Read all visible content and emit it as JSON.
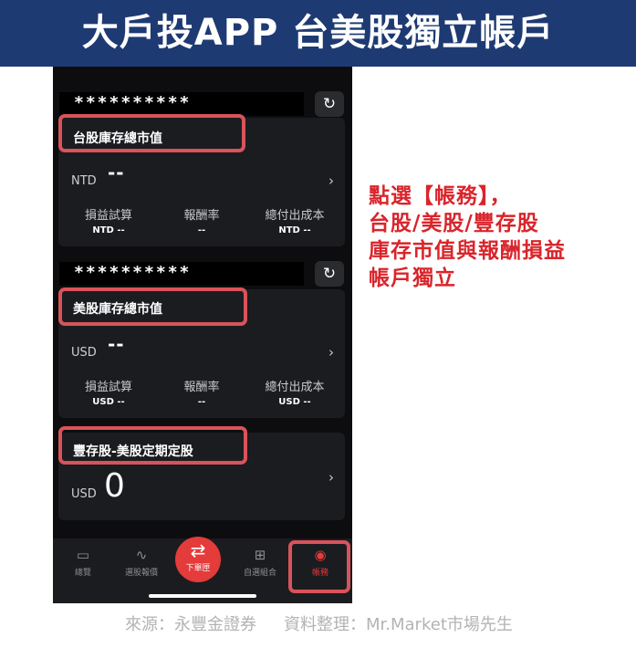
{
  "banner": {
    "title": "大戶投APP 台美股獨立帳戶"
  },
  "accounts": [
    {
      "masked_id": "**********",
      "title": "台股庫存總市值",
      "currency": "NTD",
      "value": "--",
      "stats": [
        {
          "label": "損益試算",
          "value": "NTD --"
        },
        {
          "label": "報酬率",
          "value": "--"
        },
        {
          "label": "總付出成本",
          "value": "NTD --"
        }
      ]
    },
    {
      "masked_id": "**********",
      "title": "美股庫存總市值",
      "currency": "USD",
      "value": "--",
      "stats": [
        {
          "label": "損益試算",
          "value": "USD --"
        },
        {
          "label": "報酬率",
          "value": "--"
        },
        {
          "label": "總付出成本",
          "value": "USD --"
        }
      ]
    },
    {
      "title": "豐存股-美股定期定股",
      "currency": "USD",
      "value": "0"
    }
  ],
  "tabbar": {
    "items": [
      {
        "label": "總覽",
        "icon": "monitor-icon"
      },
      {
        "label": "選股報價",
        "icon": "trend-icon"
      },
      {
        "label": "下單匣",
        "icon": "order-icon"
      },
      {
        "label": "自選組合",
        "icon": "grid-icon"
      },
      {
        "label": "帳務",
        "icon": "record-icon",
        "active": true
      }
    ]
  },
  "annotation": {
    "lines": [
      "點選【帳務】，",
      "台股/美股/豐存股",
      "庫存市值與報酬損益",
      "帳戶獨立"
    ]
  },
  "footer": {
    "source": "來源：永豐金證券",
    "credit": "資料整理：Mr.Market市場先生"
  },
  "colors": {
    "banner": "#1e3a73",
    "highlight": "#d9535a",
    "annotation": "#d9252b",
    "order_button": "#e43b3b"
  }
}
